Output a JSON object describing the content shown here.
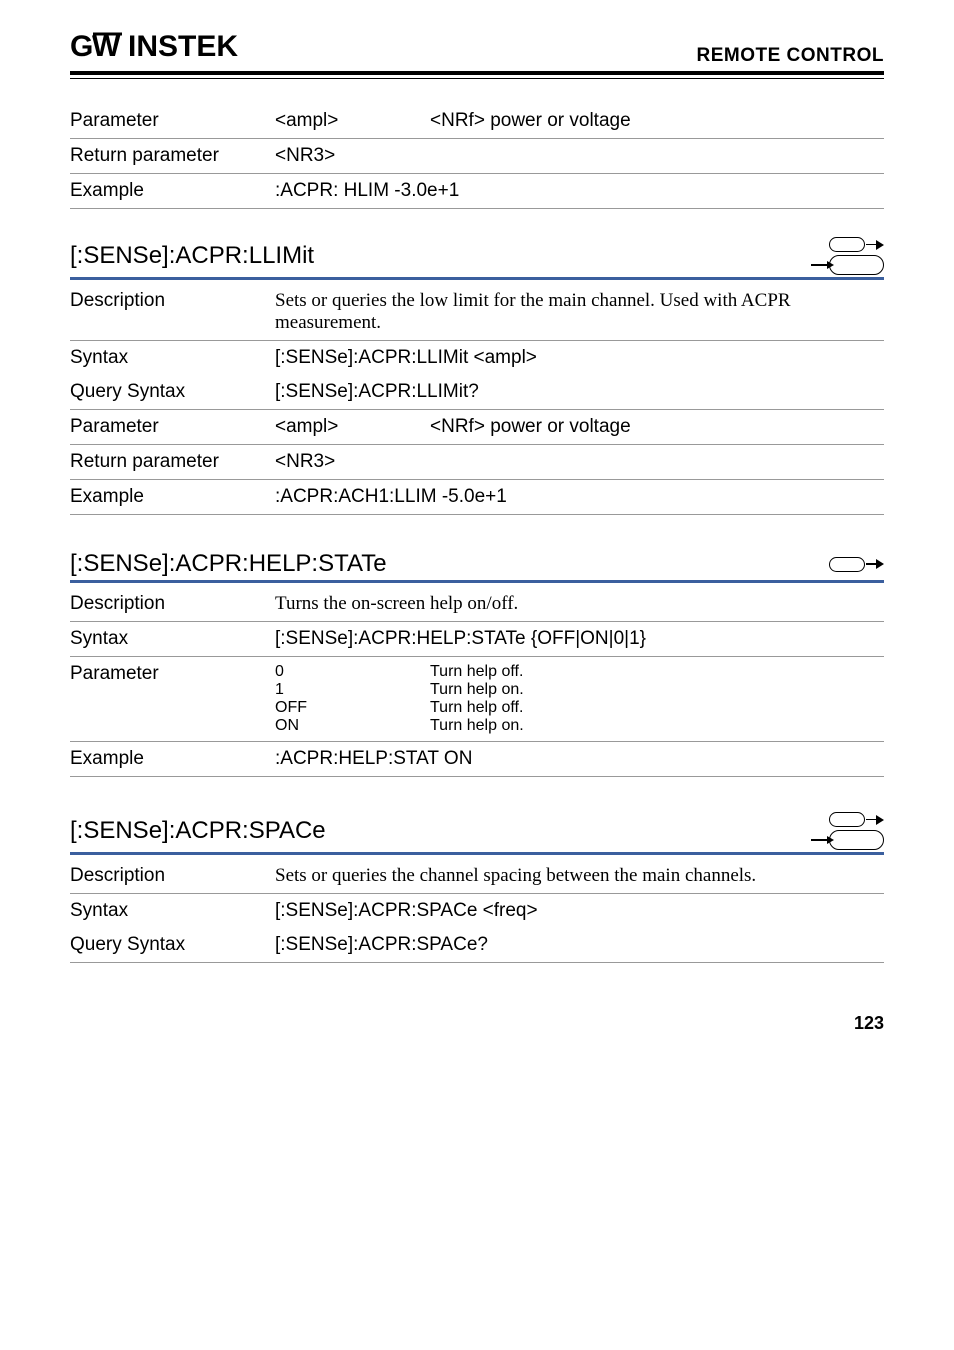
{
  "header": {
    "logo": "G",
    "logo_w": "W",
    "logo_rest": "INSTEK",
    "title": "REMOTE CONTROL"
  },
  "section1": {
    "rows": [
      {
        "label": "Parameter",
        "col2": "<ampl>",
        "col3": "<NRf> power or voltage"
      },
      {
        "label": "Return parameter",
        "col2": "<NR3>",
        "col3": ""
      },
      {
        "label": "Example",
        "full": ":ACPR: HLIM -3.0e+1"
      }
    ]
  },
  "section2": {
    "title": "[:SENSe]:ACPR:LLIMit",
    "rows": [
      {
        "label": "Description",
        "full": "Sets or queries the low limit for the main channel. Used with ACPR measurement.",
        "serif": true
      },
      {
        "label": "Syntax",
        "full": "[:SENSe]:ACPR:LLIMit <ampl>"
      },
      {
        "label": "Query Syntax",
        "full": "[:SENSe]:ACPR:LLIMit?"
      },
      {
        "label": "Parameter",
        "col2": "<ampl>",
        "col3": "<NRf> power or voltage"
      },
      {
        "label": "Return parameter",
        "col2": "<NR3>",
        "col3": ""
      },
      {
        "label": "Example",
        "full": ":ACPR:ACH1:LLIM -5.0e+1"
      }
    ]
  },
  "section3": {
    "title": "[:SENSe]:ACPR:HELP:STATe",
    "rows": [
      {
        "label": "Description",
        "full": "Turns the on-screen help on/off.",
        "serif": true
      },
      {
        "label": "Syntax",
        "full": "[:SENSe]:ACPR:HELP:STATe {OFF|ON|0|1}"
      }
    ],
    "params": [
      {
        "key": "0",
        "val": "Turn help off."
      },
      {
        "key": "1",
        "val": "Turn help on."
      },
      {
        "key": "OFF",
        "val": "Turn help off."
      },
      {
        "key": "ON",
        "val": "Turn help on."
      }
    ],
    "param_label": "Parameter",
    "example": {
      "label": "Example",
      "full": ":ACPR:HELP:STAT ON"
    }
  },
  "section4": {
    "title": "[:SENSe]:ACPR:SPACe",
    "rows": [
      {
        "label": "Description",
        "full": "Sets or queries the channel spacing between the main channels.",
        "serif": true
      },
      {
        "label": "Syntax",
        "full": "[:SENSe]:ACPR:SPACe <freq>"
      },
      {
        "label": "Query Syntax",
        "full": "[:SENSe]:ACPR:SPACe?"
      }
    ]
  },
  "page": "123"
}
